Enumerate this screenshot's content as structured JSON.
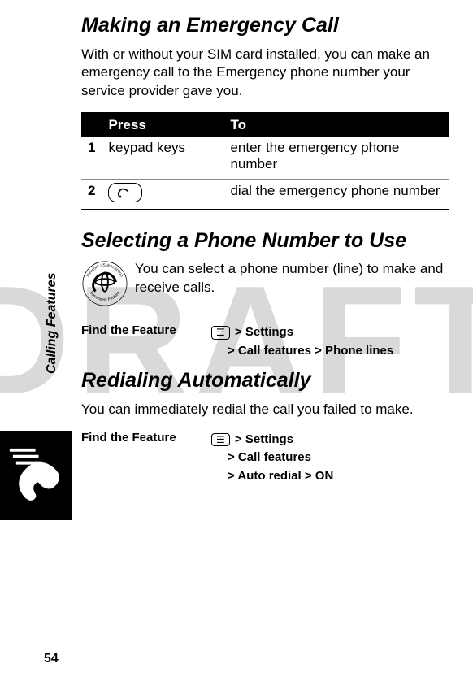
{
  "watermark": "DRAFT",
  "sidebar": "Calling Features",
  "page_number": "54",
  "section1": {
    "title": "Making an Emergency Call",
    "intro": "With or without your SIM card installed, you can make an emergency call to the Emergency phone number your service provider gave you.",
    "table": {
      "headers": {
        "press": "Press",
        "to": "To"
      },
      "rows": [
        {
          "num": "1",
          "press": "keypad keys",
          "to": "enter the emergency phone number"
        },
        {
          "num": "2",
          "press": "__SEND_ICON__",
          "to": "dial the emergency phone number"
        }
      ]
    }
  },
  "section2": {
    "title": "Selecting a Phone Number to Use",
    "intro": "You can select a phone number (line) to make and receive calls.",
    "find_label": "Find the Feature",
    "path_lines": [
      "> Settings",
      "> Call features > Phone lines"
    ]
  },
  "section3": {
    "title": "Redialing Automatically",
    "intro": "You can immediately redial the call you failed to make.",
    "find_label": "Find the Feature",
    "path_lines": [
      "> Settings",
      "> Call features",
      "> Auto redial > ON"
    ]
  }
}
